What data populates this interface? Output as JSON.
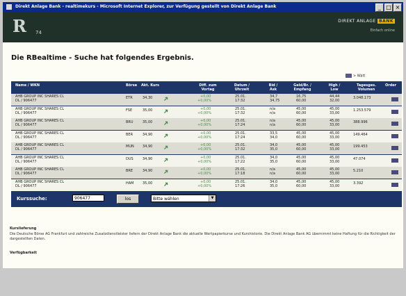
{
  "window": {
    "title": "Direkt Anlage Bank - realtimekurs - Microsoft Internet Explorer, zur Verfügung gestellt von Direkt Anlage Bank",
    "controls": [
      "_",
      "□",
      "×"
    ]
  },
  "header": {
    "logo_text": "R",
    "logo_sub": "74",
    "brand_prefix": "DIREKT ANLAGE",
    "brand_bank": "BANK",
    "brand_sub": "Einfach online"
  },
  "page": {
    "heading": "Die RBealtime - Suche hat folgendes Ergebnis.",
    "watchlist_label": "> Watt"
  },
  "table": {
    "columns": [
      "Name / WKN",
      "Börse",
      "Akt. Kurs",
      "Diff. zum Vortag",
      "Datum / Uhrzeit",
      "Bid / Ask",
      "Geld/Br. / Empfang",
      "High / Low",
      "Tagesges. Volumen",
      "Order"
    ],
    "rows": [
      {
        "name": "AHB GROUP INC SHARES CL",
        "wkn": "DL / 906477",
        "exchange": "ETR",
        "price": "34,30",
        "diff": "+0,00",
        "diff_pct": "+0,00%",
        "date": "25.01.",
        "time": "17:32",
        "bid": "34,7",
        "ask": "34,75",
        "geld": "16,75",
        "brief": "60,00",
        "high": "44,44",
        "low": "32,00",
        "volume": "3.048.173"
      },
      {
        "name": "AHB GROUP INC SHARES CL",
        "wkn": "DL / 906477",
        "exchange": "FSE",
        "price": "35,00",
        "diff": "+0,00",
        "diff_pct": "+0,00%",
        "date": "25.01.",
        "time": "17:32",
        "bid": "n/a",
        "ask": "n/a",
        "geld": "45,00",
        "brief": "60,00",
        "high": "45,00",
        "low": "33,00",
        "volume": "1.253.579"
      },
      {
        "name": "AHB GROUP INC SHARES CL",
        "wkn": "DL / 906477",
        "exchange": "BRU",
        "price": "35,00",
        "diff": "+0,00",
        "diff_pct": "+0,00%",
        "date": "25.01.",
        "time": "17:24",
        "bid": "n/a",
        "ask": "n/a",
        "geld": "45,00",
        "brief": "60,00",
        "high": "45,00",
        "low": "33,00",
        "volume": "388.996"
      },
      {
        "name": "AHB GROUP INC SHARES CL",
        "wkn": "DL / 906477",
        "exchange": "BER",
        "price": "34,90",
        "diff": "+0,00",
        "diff_pct": "+0,00%",
        "date": "25.01.",
        "time": "17:24",
        "bid": "33,5",
        "ask": "34,0",
        "geld": "45,00",
        "brief": "60,00",
        "high": "45,00",
        "low": "33,00",
        "volume": "149.464"
      },
      {
        "name": "AHB GROUP INC SHARES CL",
        "wkn": "DL / 906477",
        "exchange": "MUN",
        "price": "34,90",
        "diff": "+0,00",
        "diff_pct": "+0,00%",
        "date": "25.01.",
        "time": "17:32",
        "bid": "34,0",
        "ask": "35,0",
        "geld": "45,00",
        "brief": "60,00",
        "high": "45,00",
        "low": "33,00",
        "volume": "199.453"
      },
      {
        "name": "AHB GROUP INC SHARES CL",
        "wkn": "DL / 906477",
        "exchange": "DUS",
        "price": "34,90",
        "diff": "+0,00",
        "diff_pct": "+0,00%",
        "date": "25.01.",
        "time": "17:22",
        "bid": "34,0",
        "ask": "35,0",
        "geld": "45,00",
        "brief": "60,00",
        "high": "45,00",
        "low": "33,00",
        "volume": "47.074"
      },
      {
        "name": "AHB GROUP INC SHARES CL",
        "wkn": "DL / 906477",
        "exchange": "BRE",
        "price": "34,90",
        "diff": "+0,00",
        "diff_pct": "+0,00%",
        "date": "25.01.",
        "time": "17:18",
        "bid": "n/a",
        "ask": "n/a",
        "geld": "45,00",
        "brief": "60,00",
        "high": "45,00",
        "low": "33,00",
        "volume": "5.210"
      },
      {
        "name": "AHB GROUP INC SHARES CL",
        "wkn": "DL / 906477",
        "exchange": "HAM",
        "price": "35,00",
        "diff": "+0,00",
        "diff_pct": "+0,00%",
        "date": "25.01.",
        "time": "17:26",
        "bid": "34,0",
        "ask": "35,0",
        "geld": "45,00",
        "brief": "60,00",
        "high": "45,00",
        "low": "33,00",
        "volume": "3.392"
      }
    ]
  },
  "search": {
    "label": "Kurssuche:",
    "value": "906477",
    "button_label": "los",
    "select_value": "Bitte wählen"
  },
  "notes": {
    "section1_title": "Kurslieferung",
    "section1_text": "Die Deutsche Börse AG Frankfurt und zahlreiche Zusatzdienstleister liefern der Direkt Anlage Bank die aktuelle Wertpapierkurse und Kurshistorie. Die Direkt Anlage Bank AG übernimmt keine Haftung für die Richtigkeit der dargestellten Daten.",
    "section2_title": "Verfügbarkeit"
  },
  "colors": {
    "title_bar": "#0a2a8c",
    "header": "#1f3128",
    "table_header": "#1d3568",
    "row_even": "#dcdcd2",
    "row_odd": "#f4f4ec",
    "diff_green": "#4a8c4a"
  }
}
